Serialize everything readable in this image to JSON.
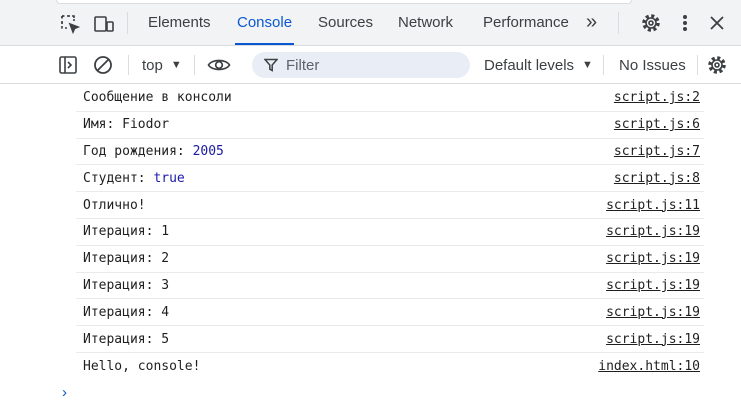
{
  "tabs": [
    {
      "label": "Elements"
    },
    {
      "label": "Console"
    },
    {
      "label": "Sources"
    },
    {
      "label": "Network"
    },
    {
      "label": "Performance"
    }
  ],
  "active_tab": "Console",
  "overflow_label": "»",
  "toolbar": {
    "context": "top",
    "filter_placeholder": "Filter",
    "levels": "Default levels",
    "issues": "No Issues"
  },
  "messages": [
    {
      "text": "Сообщение в консоли",
      "value": "",
      "source": "script.js:2"
    },
    {
      "text": "Имя: Fiodor",
      "value": "",
      "source": "script.js:6"
    },
    {
      "text": "Год рождения: ",
      "value": "2005",
      "source": "script.js:7"
    },
    {
      "text": "Студент: ",
      "value": "true",
      "source": "script.js:8"
    },
    {
      "text": "Отлично!",
      "value": "",
      "source": "script.js:11"
    },
    {
      "text": "Итерация: 1",
      "value": "",
      "source": "script.js:19"
    },
    {
      "text": "Итерация: 2",
      "value": "",
      "source": "script.js:19"
    },
    {
      "text": "Итерация: 3",
      "value": "",
      "source": "script.js:19"
    },
    {
      "text": "Итерация: 4",
      "value": "",
      "source": "script.js:19"
    },
    {
      "text": "Итерация: 5",
      "value": "",
      "source": "script.js:19"
    },
    {
      "text": "Hello, console!",
      "value": "",
      "source": "index.html:10"
    }
  ],
  "prompt_symbol": "›",
  "colors": {
    "accent": "#0b57d0",
    "value": "#1a1aa6"
  },
  "icons": [
    "inspect-element-icon",
    "device-toolbar-icon",
    "settings-gear-icon",
    "more-vert-icon",
    "close-icon",
    "sidebar-toggle-icon",
    "clear-console-icon",
    "eye-icon",
    "filter-icon",
    "console-settings-gear-icon"
  ]
}
